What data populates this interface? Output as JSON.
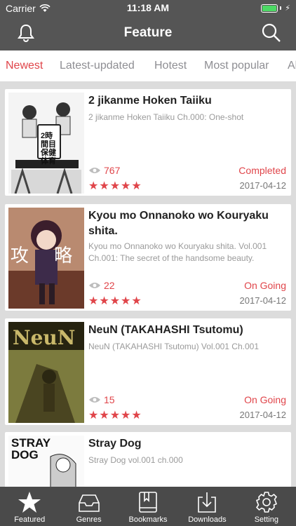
{
  "status_bar": {
    "carrier": "Carrier",
    "time": "11:18 AM"
  },
  "nav": {
    "title": "Feature",
    "left_icon": "bell-icon",
    "right_icon": "search-icon"
  },
  "tabs": [
    {
      "label": "Newest",
      "active": true
    },
    {
      "label": "Latest-updated",
      "active": false
    },
    {
      "label": "Hotest",
      "active": false
    },
    {
      "label": "Most popular",
      "active": false
    },
    {
      "label": "Al",
      "active": false
    }
  ],
  "items": [
    {
      "title": "2 jikanme Hoken Taiiku",
      "description": "2 jikanme Hoken Taiiku Ch.000: One-shot",
      "views": "767",
      "status": "Completed",
      "stars": "★★★★★",
      "date": "2017-04-12"
    },
    {
      "title": "Kyou mo Onnanoko wo Kouryaku shita.",
      "description": "Kyou mo Onnanoko wo Kouryaku shita. Vol.001 Ch.001: The secret of the handsome beauty.",
      "views": "22",
      "status": "On Going",
      "stars": "★★★★★",
      "date": "2017-04-12"
    },
    {
      "title": "NeuN (TAKAHASHI Tsutomu)",
      "description": "NeuN (TAKAHASHI Tsutomu) Vol.001 Ch.001",
      "views": "15",
      "status": "On Going",
      "stars": "★★★★★",
      "date": "2017-04-12"
    },
    {
      "title": "Stray Dog",
      "description": "Stray Dog vol.001 ch.000"
    }
  ],
  "cover_art_text": {
    "c1": "2時間目 保健体育",
    "c2": "攻 略",
    "c3": "NeuN",
    "c4": "STRAY DOG"
  },
  "tabbar": [
    {
      "label": "Featured",
      "icon": "star-icon",
      "active": true
    },
    {
      "label": "Genres",
      "icon": "inbox-icon",
      "active": false
    },
    {
      "label": "Bookmarks",
      "icon": "book-icon",
      "active": false
    },
    {
      "label": "Downloads",
      "icon": "download-icon",
      "active": false
    },
    {
      "label": "Setting",
      "icon": "gear-icon",
      "active": false
    }
  ],
  "colors": {
    "accent": "#e0454a",
    "header": "#555555",
    "tabbar": "#4a4a4a"
  }
}
